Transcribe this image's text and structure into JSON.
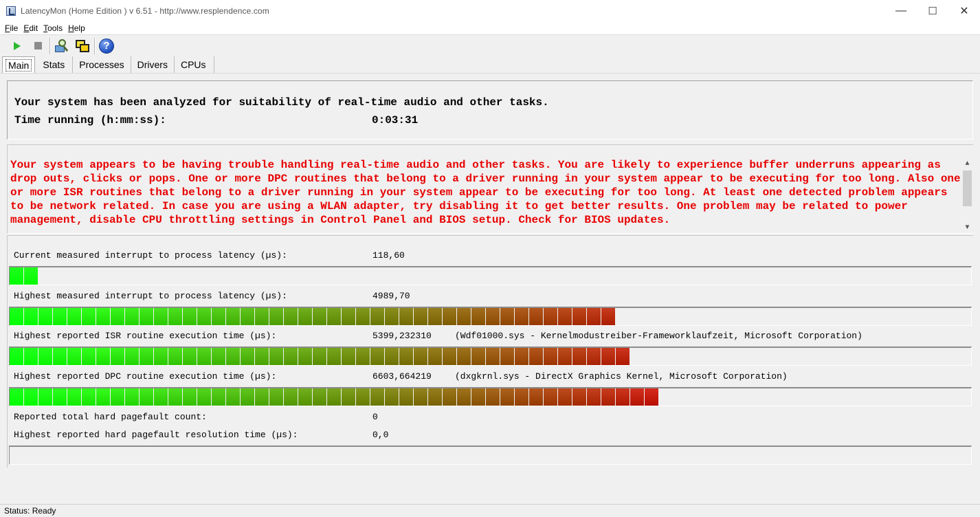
{
  "window": {
    "title": "LatencyMon  (Home Edition )  v 6.51 - http://www.resplendence.com",
    "minimize": "—",
    "maximize": "☐",
    "close": "✕"
  },
  "menu": [
    {
      "label": "File",
      "key": "F",
      "rest": "ile"
    },
    {
      "label": "Edit",
      "key": "E",
      "rest": "dit"
    },
    {
      "label": "Tools",
      "key": "T",
      "rest": "ools"
    },
    {
      "label": "Help",
      "key": "H",
      "rest": "elp"
    }
  ],
  "toolbar": {
    "icons": [
      "play-icon",
      "stop-icon",
      "monitor-magnifier-icon",
      "windows-icon",
      "help-icon"
    ],
    "help_glyph": "?"
  },
  "tabs": [
    {
      "label": "Main",
      "active": true
    },
    {
      "label": "Stats",
      "active": false
    },
    {
      "label": "Processes",
      "active": false
    },
    {
      "label": "Drivers",
      "active": false
    },
    {
      "label": "CPUs",
      "active": false
    }
  ],
  "summary": {
    "headline": "Your system has been analyzed for suitability of real-time audio and other tasks.",
    "time_label": "Time running (h:mm:ss):",
    "time_value": "0:03:31"
  },
  "message": {
    "text": "Your system appears to be having trouble handling real-time audio and other tasks. You are likely to experience buffer underruns appearing as drop outs, clicks or pops. One or more DPC routines that belong to a driver running in your system appear to be executing for too long. Also one or more ISR routines that belong to a driver running in your system appear to be executing for too long. At least one detected problem appears to be network related. In case you are using a WLAN adapter, try disabling it to get better results. One problem may be related to power management, disable CPU throttling settings in Control Panel and BIOS setup. Check for BIOS updates.",
    "color": "#e80000"
  },
  "stats": {
    "current_latency": {
      "label": "Current measured interrupt to process latency (µs):",
      "value": "118,60",
      "segments": 2
    },
    "highest_latency": {
      "label": "Highest measured interrupt to process latency (µs):",
      "value": "4989,70",
      "segments": 42
    },
    "isr": {
      "label": "Highest reported ISR routine execution time (µs):",
      "value": "5399,232310",
      "detail": "(Wdf01000.sys - Kernelmodustreiber-Frameworklaufzeit, Microsoft Corporation)",
      "segments": 43
    },
    "dpc": {
      "label": "Highest reported DPC routine execution time (µs):",
      "value": "6603,664219",
      "detail": "(dxgkrnl.sys - DirectX Graphics Kernel, Microsoft Corporation)",
      "segments": 45
    },
    "pagefault_count": {
      "label": "Reported total hard pagefault count:",
      "value": "0"
    },
    "pagefault_time": {
      "label": "Highest reported hard pagefault resolution time (µs):",
      "value": "0,0",
      "segments": 0
    }
  },
  "colors": {
    "meter_start": "#00ff00",
    "meter_end": "#c00000"
  },
  "status": {
    "text": "Status: Ready"
  }
}
